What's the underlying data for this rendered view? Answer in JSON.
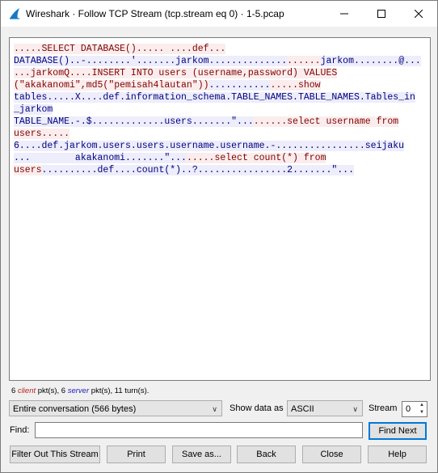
{
  "window": {
    "title": "Wireshark · Follow TCP Stream (tcp.stream eq 0) · 1-5.pcap"
  },
  "stream_lines": [
    [
      {
        "t": ".....SELECT DATABASE()..... ....def...",
        "k": "c"
      }
    ],
    [
      {
        "t": "DATABASE()..-........'.......jarkom..............",
        "k": "s"
      },
      {
        "t": "......",
        "k": "c"
      },
      {
        "t": "jarkom........@...",
        "k": "s"
      }
    ],
    [
      {
        "t": "...jarkomQ....INSERT INTO users (username,password) VALUES",
        "k": "c"
      }
    ],
    [
      {
        "t": "(\"akakanomi\",md5(\"pemisah4lautan\"))",
        "k": "c"
      },
      {
        "t": "...........",
        "k": "s"
      },
      {
        "t": ".....show",
        "k": "c"
      }
    ],
    [
      {
        "t": "tables.....X....def.information_schema.TABLE_NAMES.TABLE_NAMES.Tables_in",
        "k": "s"
      }
    ],
    [
      {
        "t": "_jarkom",
        "k": "s"
      }
    ],
    [
      {
        "t": "TABLE_NAME.-.$.............users.......\"...",
        "k": "s"
      },
      {
        "t": "......select username from",
        "k": "c"
      }
    ],
    [
      {
        "t": "users.....",
        "k": "c"
      }
    ],
    [
      {
        "t": "6....def.jarkom.users.users.username.username.-................seijaku",
        "k": "s"
      }
    ],
    [
      {
        "t": "...        akakanomi.......\"...",
        "k": "s"
      },
      {
        "t": ".....select count(*) from",
        "k": "c"
      }
    ],
    [
      {
        "t": "users",
        "k": "c"
      },
      {
        "t": "..........def....count(*)..?................2.......\"...",
        "k": "s"
      }
    ]
  ],
  "stats": {
    "client_count": "6",
    "client_word": "client",
    "client_suffix": " pkt(s), ",
    "server_count": "6",
    "server_word": "server",
    "server_suffix": " pkt(s), 11 turn(s)."
  },
  "controls": {
    "conversation_select": "Entire conversation (566 bytes)",
    "show_data_label": "Show data as",
    "show_data_value": "ASCII",
    "stream_label": "Stream",
    "stream_value": "0",
    "find_label": "Find:",
    "find_value": "",
    "find_next": "Find Next"
  },
  "buttons": {
    "filter_out": "Filter Out This Stream",
    "print": "Print",
    "save_as": "Save as...",
    "back": "Back",
    "close": "Close",
    "help": "Help"
  },
  "colors": {
    "client_text": "#7f0000",
    "client_bg": "#fbeded",
    "server_text": "#00007f",
    "server_bg": "#ededfb"
  }
}
